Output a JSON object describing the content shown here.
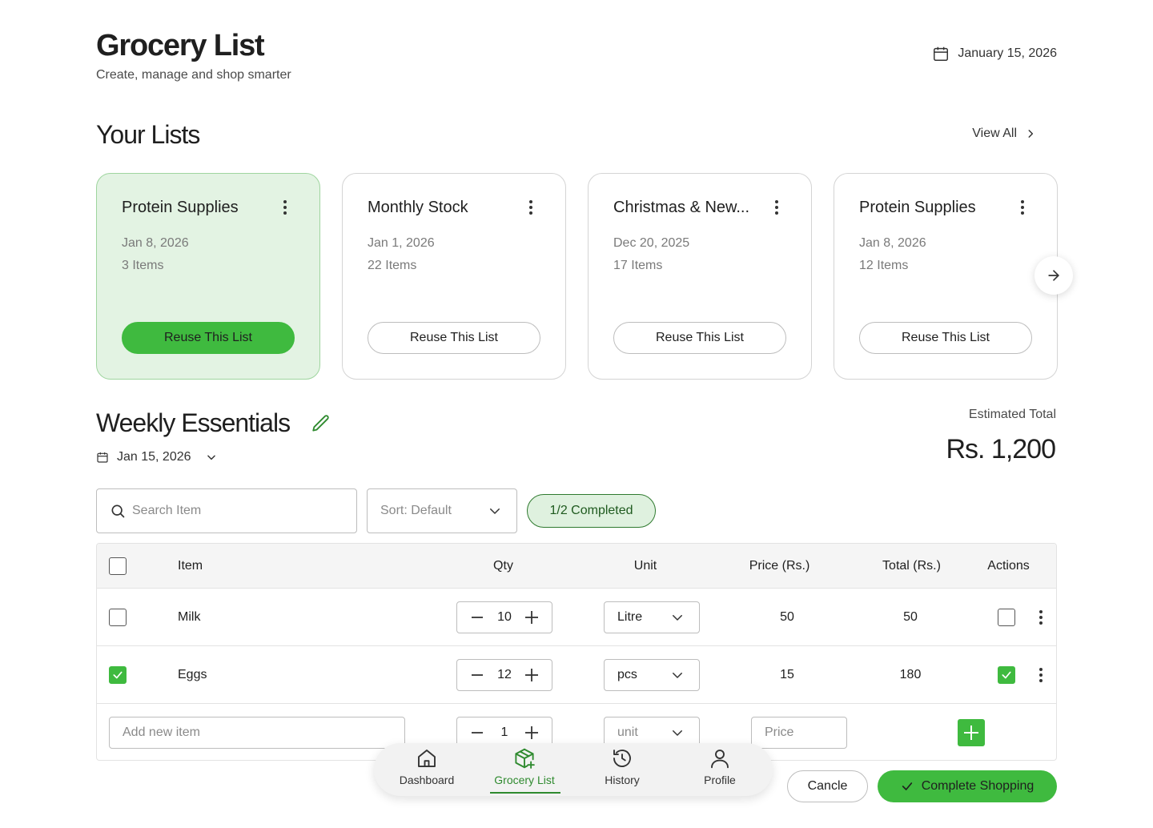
{
  "header": {
    "title": "Grocery List",
    "subtitle": "Create, manage and shop smarter",
    "date": "January 15, 2026"
  },
  "lists_section": {
    "title": "Your Lists",
    "view_all": "View All",
    "cards": [
      {
        "title": "Protein Supplies",
        "date": "Jan 8, 2026",
        "count": "3 Items",
        "button": "Reuse This List",
        "active": true
      },
      {
        "title": "Monthly Stock",
        "date": "Jan 1, 2026",
        "count": "22 Items",
        "button": "Reuse This List",
        "active": false
      },
      {
        "title": "Christmas & New...",
        "date": "Dec 20, 2025",
        "count": "17 Items",
        "button": "Reuse This List",
        "active": false
      },
      {
        "title": "Protein Supplies",
        "date": "Jan 8, 2026",
        "count": "12 Items",
        "button": "Reuse This List",
        "active": false
      }
    ]
  },
  "current_list": {
    "title": "Weekly Essentials",
    "date": "Jan 15, 2026",
    "estimated_label": "Estimated Total",
    "estimated_value": "Rs. 1,200"
  },
  "toolbar": {
    "search_placeholder": "Search Item",
    "sort_label": "Sort: Default",
    "completed": "1/2 Completed"
  },
  "table": {
    "headers": {
      "item": "Item",
      "qty": "Qty",
      "unit": "Unit",
      "price": "Price (Rs.)",
      "total": "Total (Rs.)",
      "actions": "Actions"
    },
    "rows": [
      {
        "item": "Milk",
        "qty": "10",
        "unit": "Litre",
        "price": "50",
        "total": "50",
        "checked": false
      },
      {
        "item": "Eggs",
        "qty": "12",
        "unit": "pcs",
        "price": "15",
        "total": "180",
        "checked": true
      }
    ],
    "new_row": {
      "item_placeholder": "Add new item",
      "qty": "1",
      "unit_placeholder": "unit",
      "price_placeholder": "Price"
    }
  },
  "nav": {
    "items": [
      {
        "label": "Dashboard",
        "icon": "home-icon"
      },
      {
        "label": "Grocery List",
        "icon": "package-add-icon",
        "active": true
      },
      {
        "label": "History",
        "icon": "history-icon"
      },
      {
        "label": "Profile",
        "icon": "user-icon"
      }
    ]
  },
  "actions": {
    "cancel": "Cancle",
    "complete": "Complete Shopping"
  },
  "colors": {
    "accent": "#3fba3f",
    "accent_dark": "#2f8a2f",
    "active_card_bg": "#e3f3e3"
  }
}
